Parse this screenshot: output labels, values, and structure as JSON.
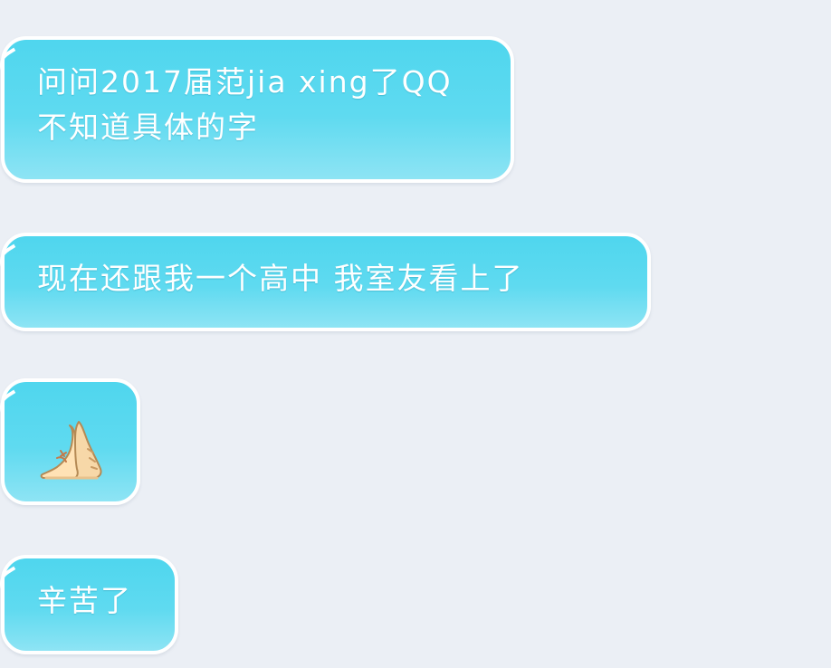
{
  "messages": [
    {
      "lines": [
        "问问2017届范jia xing了QQ",
        "不知道具体的字"
      ]
    },
    {
      "lines": [
        "现在还跟我一个高中 我室友看上了"
      ]
    },
    {
      "emoji": "praying-hands-emoji"
    },
    {
      "lines": [
        "辛苦了"
      ]
    }
  ],
  "colors": {
    "background": "#ebeff5",
    "bubble_top": "#4fd6ee",
    "bubble_bottom": "#8ee4f4",
    "bubble_border": "#ffffff",
    "text": "#ffffff"
  }
}
